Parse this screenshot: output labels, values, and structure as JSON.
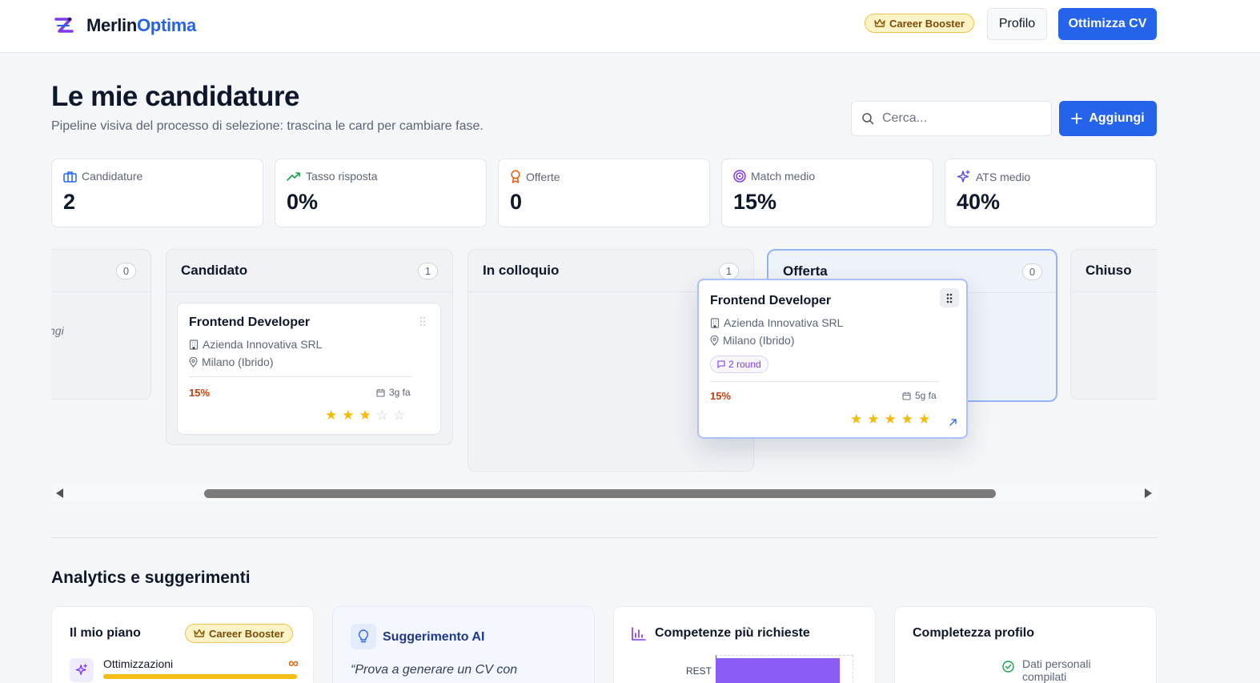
{
  "header": {
    "brand_part1": "Merlin",
    "brand_part2": "Optima",
    "plan_badge": "Career Booster",
    "profile_label": "Profilo",
    "cta_label": "Ottimizza CV"
  },
  "page": {
    "title": "Le mie candidature",
    "subtitle": "Pipeline visiva del processo di selezione: trascina le card per cambiare fase.",
    "search_placeholder": "Cerca...",
    "add_label": "Aggiungi"
  },
  "stats": [
    {
      "label": "Candidature",
      "value": "2",
      "icon": "briefcase-icon"
    },
    {
      "label": "Tasso risposta",
      "value": "0%",
      "icon": "trending-up-icon"
    },
    {
      "label": "Offerte",
      "value": "0",
      "icon": "award-icon"
    },
    {
      "label": "Match medio",
      "value": "15%",
      "icon": "target-icon"
    },
    {
      "label": "ATS medio",
      "value": "40%",
      "icon": "sparkles-icon"
    }
  ],
  "board": {
    "columns": [
      {
        "title": "",
        "count": "0",
        "empty_hint": "ngi"
      },
      {
        "title": "Candidato",
        "count": "1"
      },
      {
        "title": "In colloquio",
        "count": "1"
      },
      {
        "title": "Offerta",
        "count": "0"
      },
      {
        "title": "Chiuso",
        "count": ""
      }
    ],
    "card_candidato": {
      "title": "Frontend Developer",
      "company": "Azienda Innovativa SRL",
      "location": "Milano (Ibrido)",
      "match": "15%",
      "ago": "3g fa",
      "rating": 3
    },
    "card_dragging": {
      "title": "Frontend Developer",
      "company": "Azienda Innovativa SRL",
      "location": "Milano (Ibrido)",
      "rounds": "2 round",
      "match": "15%",
      "ago": "5g fa",
      "rating": 5
    }
  },
  "analytics": {
    "title": "Analytics e suggerimenti",
    "plan": {
      "title": "Il mio piano",
      "badge": "Career Booster",
      "optimizations_label": "Ottimizzazioni",
      "optimizations_value": "∞"
    },
    "ai": {
      "title": "Suggerimento AI",
      "quote": "“Prova a generare un CV con"
    },
    "skills": {
      "title": "Competenze più richieste",
      "items": [
        {
          "label": "REST"
        }
      ]
    },
    "profile": {
      "title": "Completezza profilo",
      "first_item": "Dati personali compilati"
    }
  },
  "colors": {
    "primary": "#2563eb",
    "gold_badge_bg": "#fdf3c7",
    "match_pct": "#c2410c",
    "star": "#f5b90a",
    "skill_bar": "#8b5cf6"
  }
}
